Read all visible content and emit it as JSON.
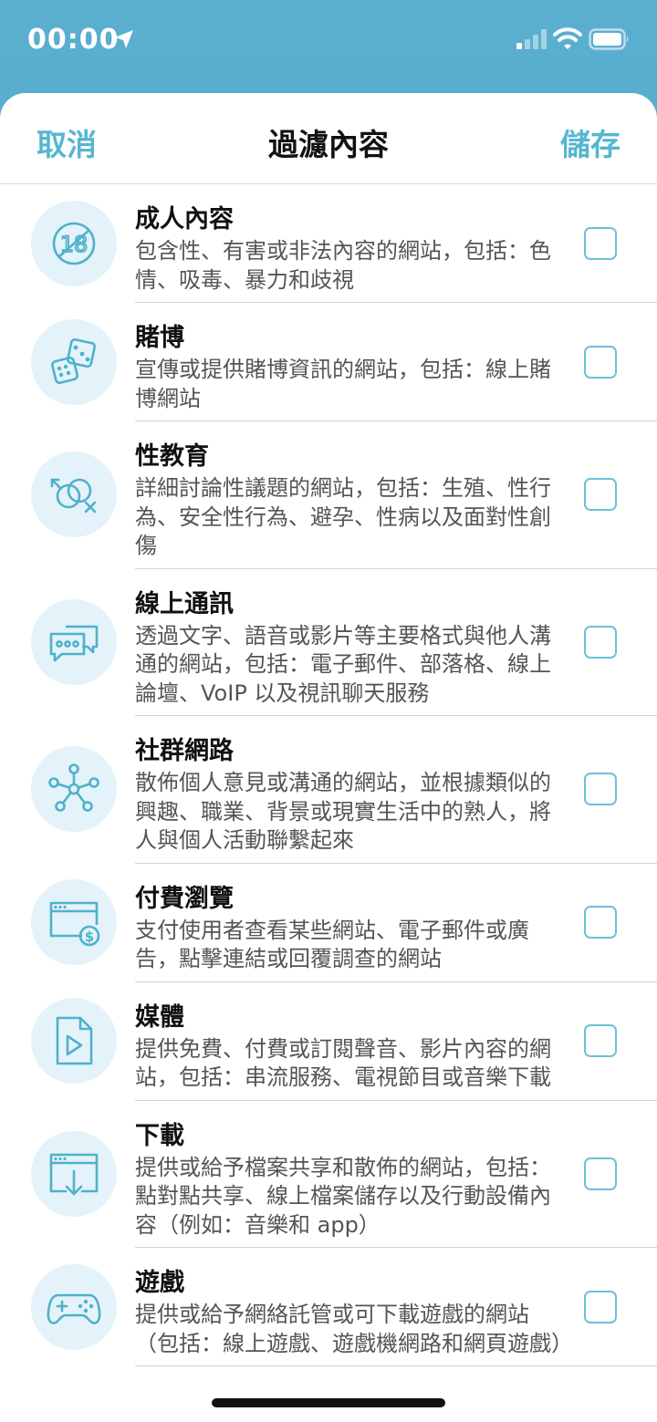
{
  "status": {
    "time": "00:00"
  },
  "nav": {
    "cancel": "取消",
    "title": "過濾內容",
    "save": "儲存"
  },
  "categories": [
    {
      "title": "成人內容",
      "desc": "包含性、有害或非法內容的網站，包括：色情、吸毒、暴力和歧視",
      "icon": "age-18-restricted-icon",
      "checked": false
    },
    {
      "title": "賭博",
      "desc": "宣傳或提供賭博資訊的網站，包括：線上賭博網站",
      "icon": "dice-icon",
      "checked": false
    },
    {
      "title": "性教育",
      "desc": "詳細討論性議題的網站，包括：生殖、性行為、安全性行為、避孕、性病以及面對性創傷",
      "icon": "gender-symbols-icon",
      "checked": false
    },
    {
      "title": "線上通訊",
      "desc": "透過文字、語音或影片等主要格式與他人溝通的網站，包括：電子郵件、部落格、線上論壇、VoIP 以及視訊聊天服務",
      "icon": "chat-bubbles-icon",
      "checked": false
    },
    {
      "title": "社群網路",
      "desc": "散佈個人意見或溝通的網站，並根據類似的興趣、職業、背景或現實生活中的熟人，將人與個人活動聯繫起來",
      "icon": "network-nodes-icon",
      "checked": false
    },
    {
      "title": "付費瀏覽",
      "desc": "支付使用者查看某些網站、電子郵件或廣告，點擊連結或回覆調查的網站",
      "icon": "paid-browser-icon",
      "checked": false
    },
    {
      "title": "媒體",
      "desc": "提供免費、付費或訂閱聲音、影片內容的網站，包括：串流服務、電視節目或音樂下載",
      "icon": "media-file-play-icon",
      "checked": false
    },
    {
      "title": "下載",
      "desc": "提供或給予檔案共享和散佈的網站，包括：點對點共享、線上檔案儲存以及行動設備內容（例如：音樂和 app）",
      "icon": "download-window-icon",
      "checked": false
    },
    {
      "title": "遊戲",
      "desc": "提供或給予網絡託管或可下載遊戲的網站（包括：線上遊戲、遊戲機網路和網頁遊戲）",
      "icon": "gamepad-icon",
      "checked": false
    }
  ]
}
